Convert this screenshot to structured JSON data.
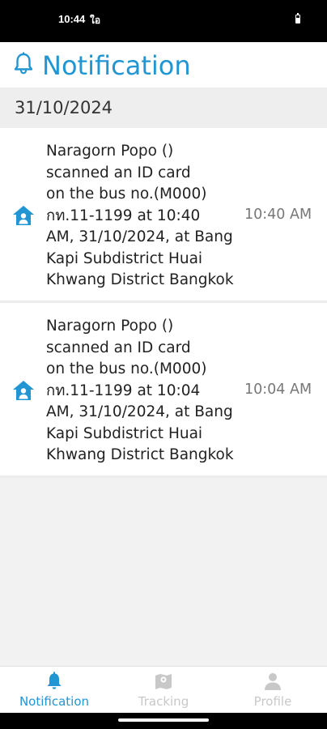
{
  "status_bar": {
    "time": "10:44",
    "app_icon_text": "ใอ",
    "battery_icon": "battery-icon"
  },
  "header": {
    "title": "Notification",
    "icon": "bell-icon",
    "accent_color": "#2196d3"
  },
  "date_section": {
    "date": "31/10/2024"
  },
  "notifications": [
    {
      "icon": "home-person-icon",
      "message": "Naragorn Popo ()\nscanned an ID card\non the bus no.(M000)\nกท.11-1199 at 10:40\nAM, 31/10/2024, at Bang\nKapi Subdistrict Huai\nKhwang District Bangkok",
      "time": "10:40 AM"
    },
    {
      "icon": "home-person-icon",
      "message": "Naragorn Popo ()\nscanned an ID card\non the bus no.(M000)\nกท.11-1199 at 10:04\nAM, 31/10/2024, at Bang\nKapi Subdistrict Huai\nKhwang District Bangkok",
      "time": "10:04 AM"
    }
  ],
  "bottom_nav": {
    "items": [
      {
        "label": "Notification",
        "icon": "bell-icon",
        "active": true
      },
      {
        "label": "Tracking",
        "icon": "map-icon",
        "active": false
      },
      {
        "label": "Profile",
        "icon": "person-icon",
        "active": false
      }
    ],
    "active_color": "#2196d3",
    "inactive_color": "#c8c8c8"
  }
}
